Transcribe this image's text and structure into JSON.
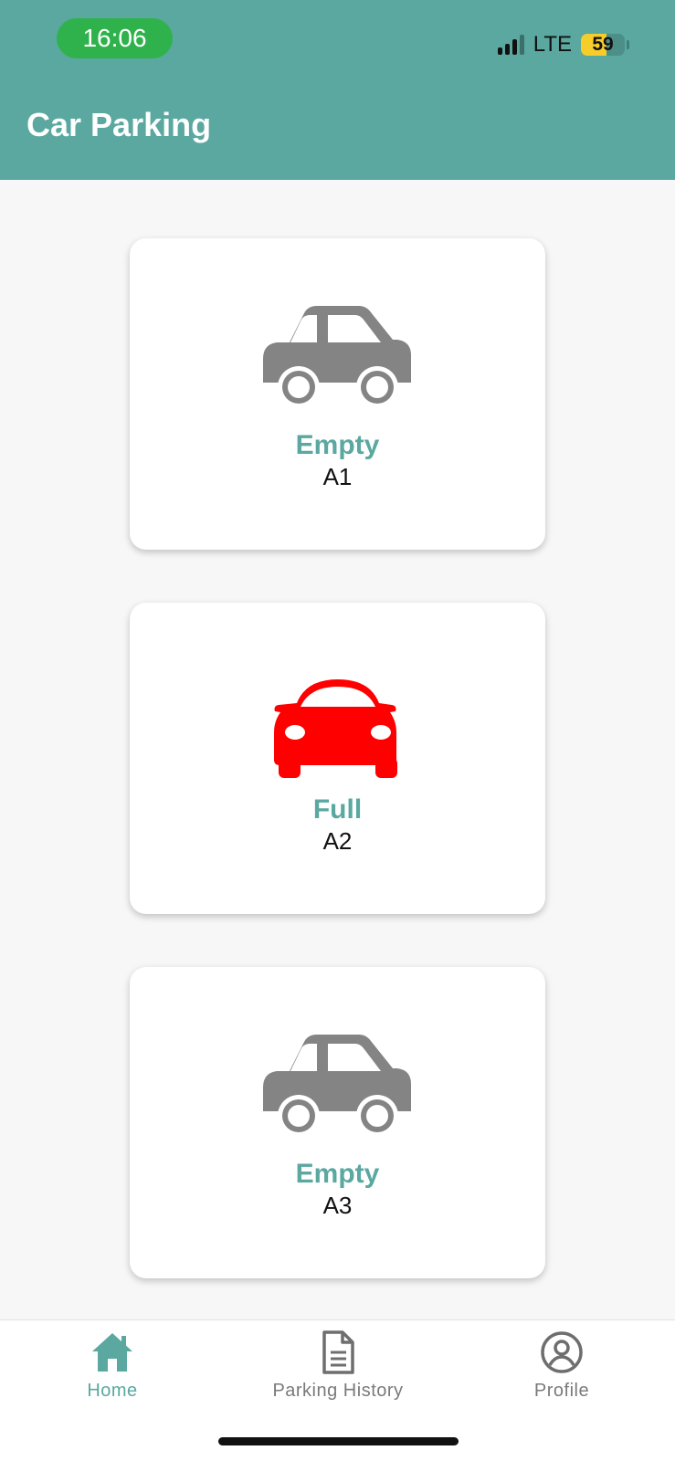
{
  "status_bar": {
    "time": "16:06",
    "network": "LTE",
    "battery": "59",
    "battery_level": 0.59
  },
  "header": {
    "title": "Car Parking"
  },
  "slots": [
    {
      "status": "Empty",
      "code": "A1",
      "icon": "car-side-icon",
      "icon_color": "#848484"
    },
    {
      "status": "Full",
      "code": "A2",
      "icon": "car-front-icon",
      "icon_color": "#ff0000"
    },
    {
      "status": "Empty",
      "code": "A3",
      "icon": "car-side-icon",
      "icon_color": "#848484"
    }
  ],
  "bottom_nav": {
    "items": [
      {
        "label": "Home",
        "icon": "home-icon",
        "active": true
      },
      {
        "label": "Parking History",
        "icon": "document-icon",
        "active": false
      },
      {
        "label": "Profile",
        "icon": "profile-icon",
        "active": false
      }
    ]
  },
  "colors": {
    "primary": "#5aa8a0",
    "status_time_pill": "#2fb24c",
    "full": "#ff0000",
    "empty_icon": "#848484",
    "background": "#f7f7f8"
  }
}
